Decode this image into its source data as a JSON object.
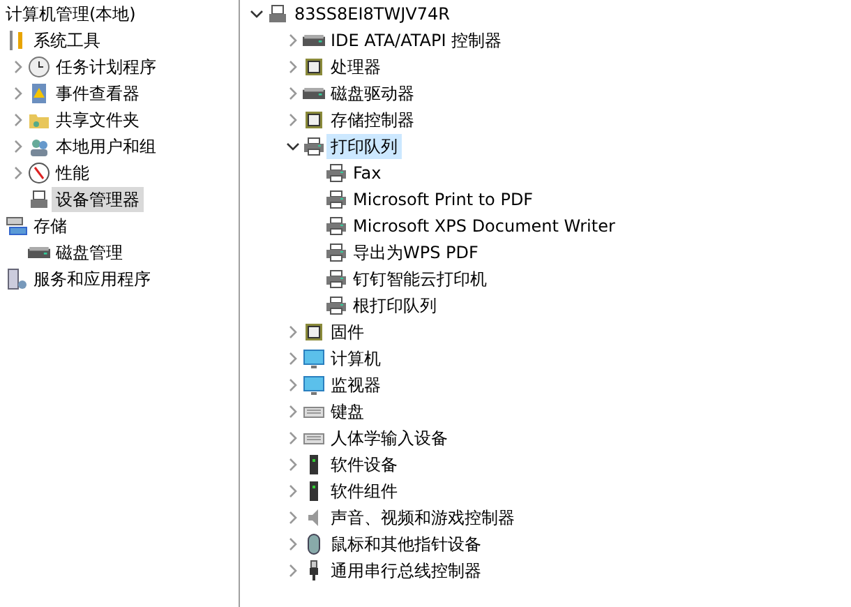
{
  "left_tree": [
    {
      "label": "计算机管理(本地)",
      "selected": false,
      "children": [
        {
          "label": "系统工具",
          "selected": false,
          "children": [
            {
              "label": "任务计划程序",
              "expanded": false,
              "selected": false
            },
            {
              "label": "事件查看器",
              "expanded": false,
              "selected": false
            },
            {
              "label": "共享文件夹",
              "expanded": false,
              "selected": false
            },
            {
              "label": "本地用户和组",
              "expanded": false,
              "selected": false
            },
            {
              "label": "性能",
              "expanded": false,
              "selected": false
            },
            {
              "label": "设备管理器",
              "selected": true
            }
          ]
        },
        {
          "label": "存储",
          "selected": false,
          "children": [
            {
              "label": "磁盘管理",
              "selected": false
            }
          ]
        },
        {
          "label": "服务和应用程序",
          "selected": false
        }
      ]
    }
  ],
  "device_tree": [
    {
      "label": "83SS8EI8TWJV74R",
      "expanded": true,
      "selected": false,
      "children": [
        {
          "label": "IDE ATA/ATAPI 控制器",
          "expanded": false,
          "selected": false
        },
        {
          "label": "处理器",
          "expanded": false,
          "selected": false
        },
        {
          "label": "磁盘驱动器",
          "expanded": false,
          "selected": false
        },
        {
          "label": "存储控制器",
          "expanded": false,
          "selected": false
        },
        {
          "label": "打印队列",
          "expanded": true,
          "selected": true,
          "children": [
            {
              "label": "Fax",
              "selected": false
            },
            {
              "label": "Microsoft Print to PDF",
              "selected": false
            },
            {
              "label": "Microsoft XPS Document Writer",
              "selected": false
            },
            {
              "label": "导出为WPS PDF",
              "selected": false
            },
            {
              "label": "钉钉智能云打印机",
              "selected": false
            },
            {
              "label": "根打印队列",
              "selected": false
            }
          ]
        },
        {
          "label": "固件",
          "expanded": false,
          "selected": false
        },
        {
          "label": "计算机",
          "expanded": false,
          "selected": false
        },
        {
          "label": "监视器",
          "expanded": false,
          "selected": false
        },
        {
          "label": "键盘",
          "expanded": false,
          "selected": false
        },
        {
          "label": "人体学输入设备",
          "expanded": false,
          "selected": false
        },
        {
          "label": "软件设备",
          "expanded": false,
          "selected": false
        },
        {
          "label": "软件组件",
          "expanded": false,
          "selected": false
        },
        {
          "label": "声音、视频和游戏控制器",
          "expanded": false,
          "selected": false
        },
        {
          "label": "鼠标和其他指针设备",
          "expanded": false,
          "selected": false
        },
        {
          "label": "通用串行总线控制器",
          "expanded": false,
          "selected": false
        }
      ]
    }
  ]
}
